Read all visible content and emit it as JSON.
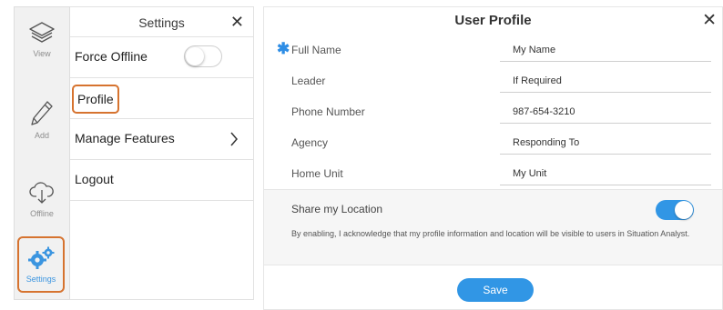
{
  "rail": {
    "items": [
      {
        "label": "View",
        "icon": "layers-icon"
      },
      {
        "label": "Add",
        "icon": "pencil-icon"
      },
      {
        "label": "Offline",
        "icon": "cloud-download-icon"
      },
      {
        "label": "Settings",
        "icon": "gears-icon",
        "active": true
      }
    ]
  },
  "settings": {
    "title": "Settings",
    "close_symbol": "✕",
    "rows": [
      {
        "label": "Force Offline",
        "toggle": false
      },
      {
        "label": "Profile",
        "highlighted": true
      },
      {
        "label": "Manage Features",
        "chevron": true
      },
      {
        "label": "Logout"
      }
    ]
  },
  "profile": {
    "title": "User Profile",
    "close_symbol": "✕",
    "required_marker": "✱",
    "fields": [
      {
        "label": "Full Name",
        "value": "My Name",
        "required": true
      },
      {
        "label": "Leader",
        "value": "If Required"
      },
      {
        "label": "Phone Number",
        "value": "987-654-3210"
      },
      {
        "label": "Agency",
        "value": "Responding To"
      },
      {
        "label": "Home Unit",
        "value": "My Unit"
      }
    ],
    "share": {
      "label": "Share my Location",
      "enabled": true,
      "description": "By enabling, I acknowledge that my profile information and location will be visible to users in Situation Analyst."
    },
    "save_label": "Save"
  },
  "colors": {
    "accent": "#3196e5",
    "highlight_outline": "#d6732f",
    "rail_bg": "#f1f1f1"
  }
}
